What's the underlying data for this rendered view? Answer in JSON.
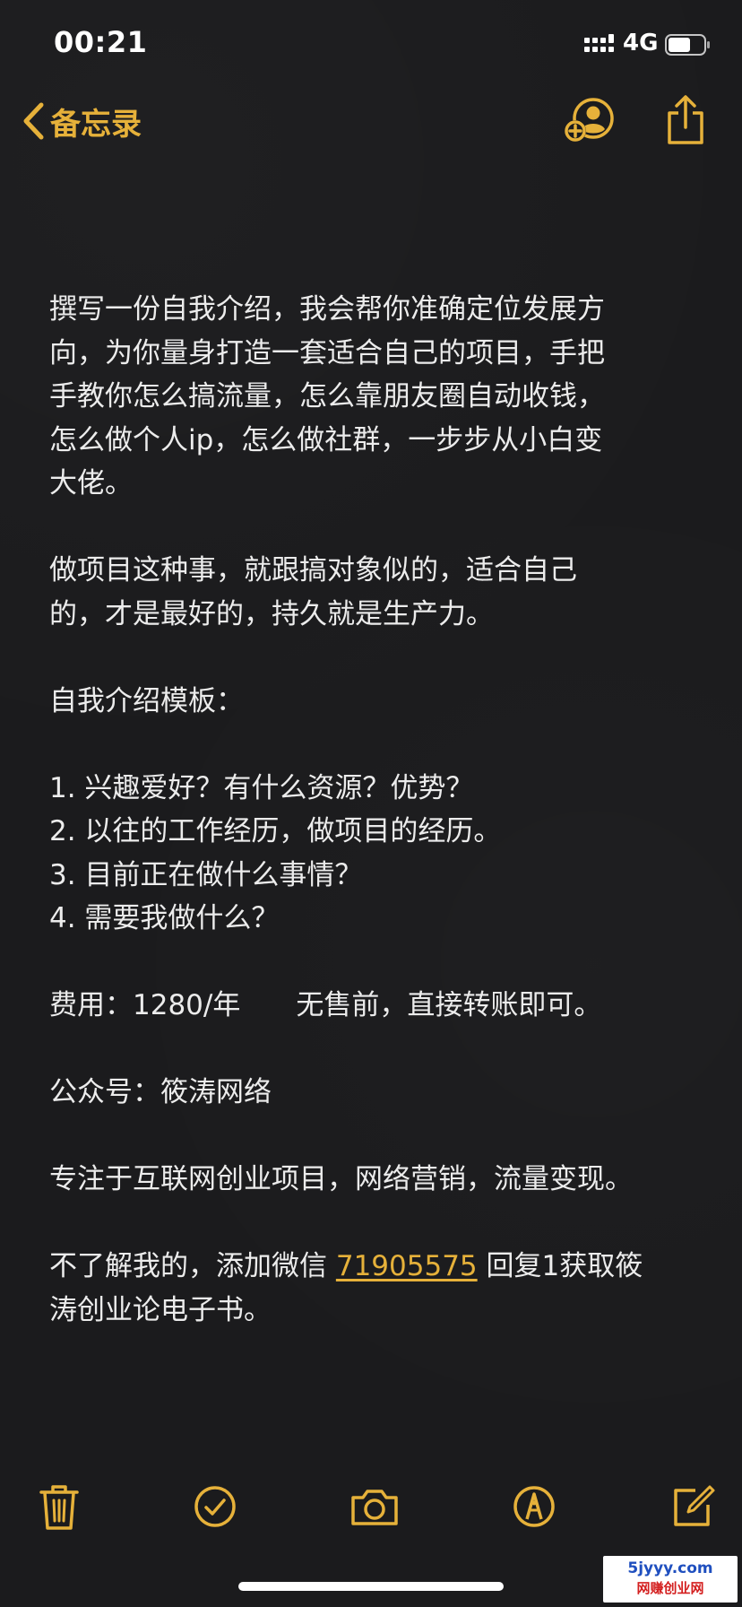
{
  "status_bar": {
    "time": "00:21",
    "network": "4G",
    "icons": [
      "signal-icon",
      "battery-icon"
    ]
  },
  "nav": {
    "back_label": "备忘录",
    "icons": [
      "back-chevron-icon",
      "add-person-icon",
      "share-icon"
    ]
  },
  "note": {
    "paragraph1": [
      "撰写一份自我介绍，我会帮你准确定位发展方",
      "向，为你量身打造一套适合自己的项目，手把",
      "手教你怎么搞流量，怎么靠朋友圈自动收钱，",
      "怎么做个人ip，怎么做社群，一步步从小白变",
      "大佬。"
    ],
    "paragraph2": [
      "做项目这种事，就跟搞对象似的，适合自己",
      "的，才是最好的，持久就是生产力。"
    ],
    "template_title": "自我介绍模板：",
    "template_items": [
      "1. 兴趣爱好？有什么资源？优势？",
      "2. 以往的工作经历，做项目的经历。",
      "3. 目前正在做什么事情？",
      "4. 需要我做什么？"
    ],
    "fee": "费用：1280/年　　无售前，直接转账即可。",
    "official_account": "公众号：筱涛网络",
    "focus": "专注于互联网创业项目，网络营销，流量变现。",
    "contact_prefix": "不了解我的，添加微信 ",
    "wechat_id": "71905575",
    "contact_suffix": " 回复1获取筱",
    "contact_line2": "涛创业论电子书。"
  },
  "toolbar": {
    "icons": [
      "trash-icon",
      "checklist-icon",
      "camera-icon",
      "markup-icon",
      "compose-icon"
    ]
  },
  "watermark": {
    "line1": "5jyyy.com",
    "line2": "网赚创业网"
  },
  "colors": {
    "accent": "#e6b13a",
    "background": "#1b1b1d",
    "text": "#ececec"
  }
}
